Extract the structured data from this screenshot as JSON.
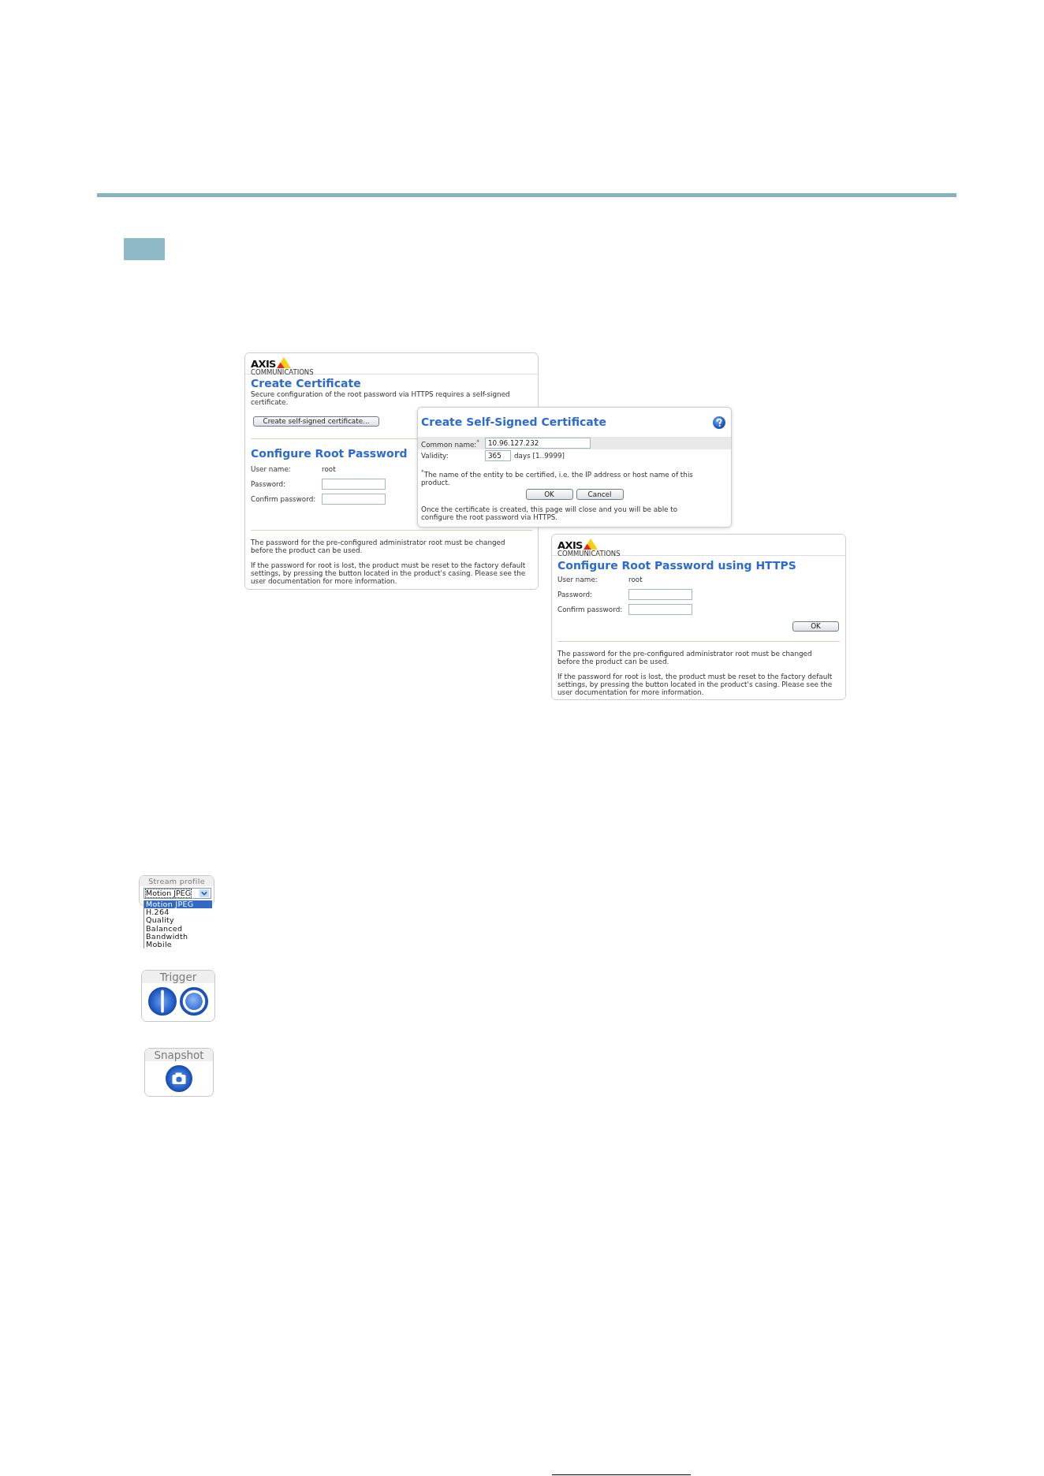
{
  "certificate_page": {
    "logo": {
      "wordmark": "AXIS",
      "tagline": "COMMUNICATIONS"
    },
    "title": "Create Certificate",
    "description": "Secure configuration of the root password via HTTPS requires a self-signed certificate.",
    "create_button": "Create self-signed certificate...",
    "password_section": {
      "title": "Configure Root Password",
      "fields": [
        {
          "label": "User name:",
          "kind": "text",
          "value": "root"
        },
        {
          "label": "Password:",
          "kind": "input"
        },
        {
          "label": "Confirm password:",
          "kind": "input"
        }
      ]
    },
    "notes": [
      "The password for the pre-configured administrator root must be changed before the product can be used.",
      "If the password for root is lost, the product must be reset to the factory default settings, by pressing the button located in the product's casing. Please see the user documentation for more information."
    ]
  },
  "certificate_dialog": {
    "title": "Create Self-Signed Certificate",
    "fields": [
      {
        "label": "Common name:$^{*}$",
        "kind": "text_field",
        "value": "10.96.127.232"
      },
      {
        "label": "Validity:",
        "kind": "number_field",
        "value": "365",
        "unit": "days [1..9999]"
      }
    ],
    "footnote": "$^{*}$The name of the entity to be certified, i.e. the IP address or host name of this product.",
    "buttons": [
      "OK",
      "Cancel"
    ],
    "message": "Once the certificate is created, this page will close and you will be able to configure the root password via HTTPS."
  },
  "https_page": {
    "logo": {
      "wordmark": "AXIS",
      "tagline": "COMMUNICATIONS"
    },
    "title": "Configure Root Password using HTTPS",
    "fields": [
      {
        "label": "User name:",
        "kind": "text",
        "value": "root"
      },
      {
        "label": "Password:",
        "kind": "input"
      },
      {
        "label": "Confirm password:",
        "kind": "input"
      }
    ],
    "button": "OK",
    "notes": [
      "The password for the pre-configured administrator root must be changed before the product can be used.",
      "If the password for root is lost, the product must be reset to the factory default settings, by pressing the button located in the product's casing. Please see the user documentation for more information."
    ]
  },
  "widgets": [
    {
      "kind": "stream_profile",
      "label": "Stream profile",
      "value": "Motion JPEG",
      "options": [
        {
          "label": "Motion JPEG",
          "selected": true
        },
        {
          "label": "H.264",
          "selected": false
        },
        {
          "label": "Quality",
          "selected": false
        },
        {
          "label": "Balanced",
          "selected": false
        },
        {
          "label": "Bandwidth",
          "selected": false
        },
        {
          "label": "Mobile",
          "selected": false
        }
      ]
    },
    {
      "kind": "trigger",
      "label": "Trigger"
    },
    {
      "kind": "snapshot",
      "label": "Snapshot"
    }
  ]
}
